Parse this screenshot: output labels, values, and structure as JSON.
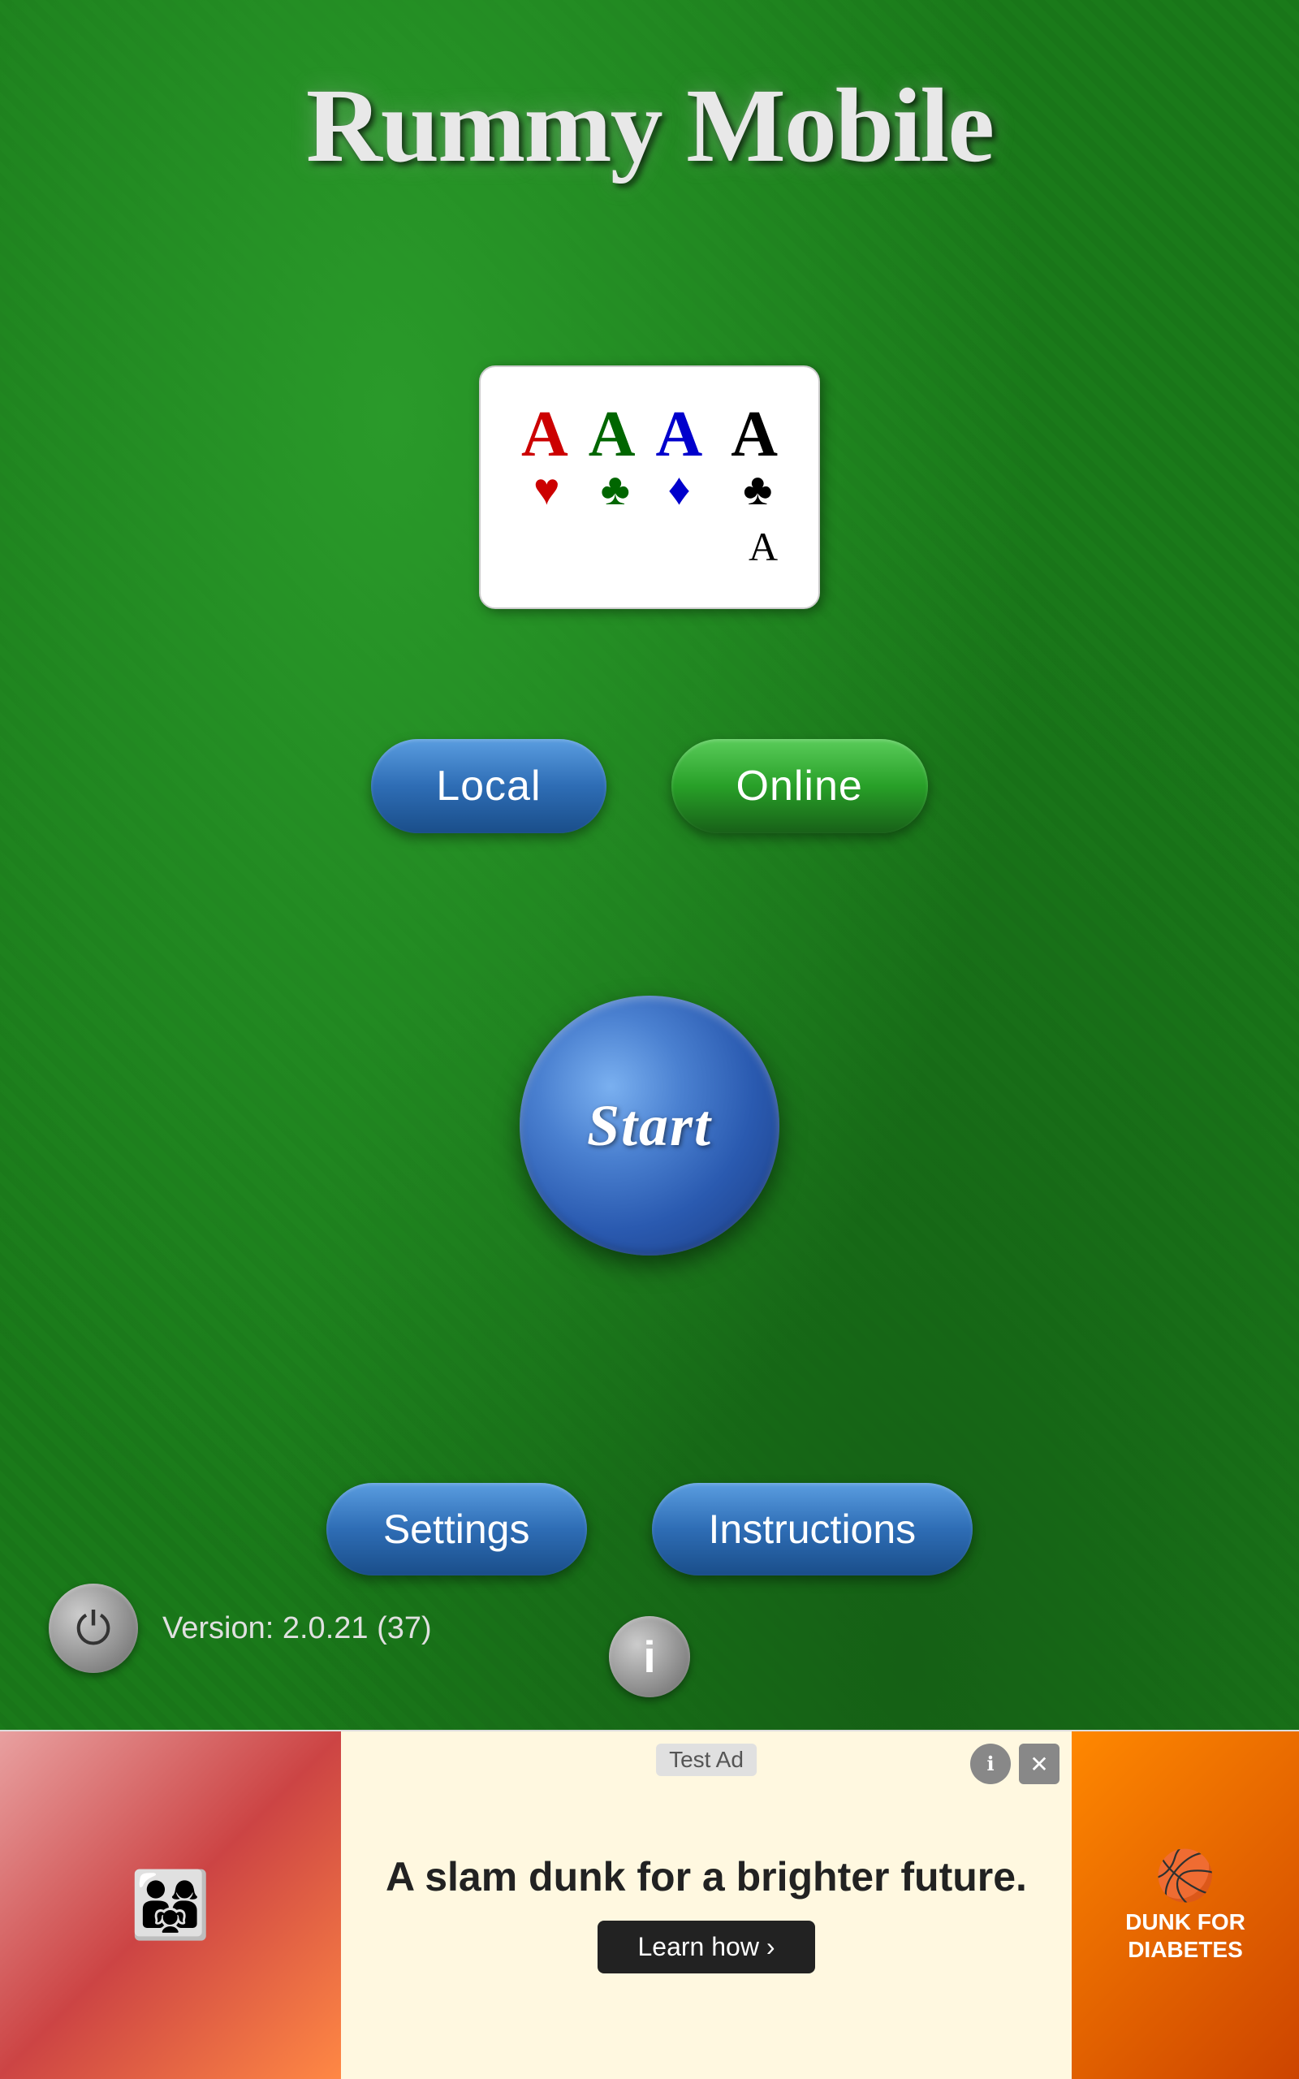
{
  "app": {
    "title": "Rummy Mobile",
    "version_label": "Version: 2.0.21 (37)"
  },
  "cards": {
    "display": "four aces"
  },
  "mode_buttons": {
    "local_label": "Local",
    "online_label": "Online"
  },
  "start_button": {
    "label": "Start"
  },
  "bottom_buttons": {
    "settings_label": "Settings",
    "instructions_label": "Instructions"
  },
  "info_button": {
    "label": "i"
  },
  "power_button": {
    "symbol": "⏻"
  },
  "ad": {
    "test_label": "Test Ad",
    "main_text": "A slam dunk for a brighter future.",
    "learn_button": "Learn how ›",
    "logo_line1": "DUNK",
    "logo_line2": "FOR",
    "logo_line3": "DIABETES"
  }
}
